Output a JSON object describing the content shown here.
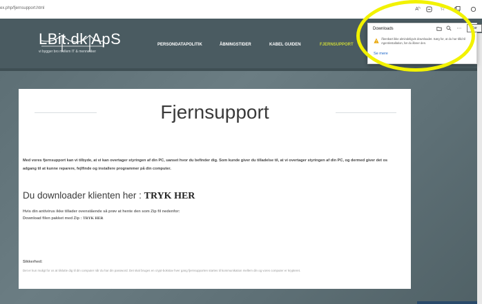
{
  "browser": {
    "url": "ex.php/fjernsupport.html",
    "read_aloud": "Aʰ",
    "tooltip": "Sor"
  },
  "site": {
    "logo": {
      "name": "LBit.dk ApS",
      "tagline": "vi bygger bro mellem IT & mennesker"
    },
    "nav": [
      {
        "label": "PERSONDATAPOLITIK"
      },
      {
        "label": "ÅBNINGSTIDER"
      },
      {
        "label": "KABEL GUIDEN"
      },
      {
        "label": "FJERNSUPPORT",
        "active": true
      }
    ],
    "page_title": "Fjernsupport",
    "intro": "Med vores fjernsupport kan vi tilbyde, at vi kan overtager styringen af din PC, uanset hvor du befinder dig. Som kunde giver du tilladelse til, at vi overtager styringen af din PC, og dermed giver det os adgang til at kunne reparere, fejlfinde og installere programmer på din computer.",
    "download_text": "Du downloader klienten her : ",
    "download_link": "TRYK HER",
    "antivirus_line1": "Hvis din antivirus ikke tillader ovenstående så prøv at hente den som Zip fil nedenfor:",
    "antivirus_line2": "Download filen pakket med Zip : ",
    "zip_link": "TRYK HER",
    "security_heading": "Sikkerhed:",
    "security_text": "Det er kun muligt for os at tilslutte dig til din computer når du har din password. Det skal bruges en crypt-bokstav hver gang fjernsupporten startes til kommunikation mellem din og vores computer er krypteret."
  },
  "downloads_panel": {
    "title": "Downloads",
    "message": "Åbenbart ikke almindeligvis downloadet. Sørg for, at du har tillid til Agentinstallation, før du åbner den.",
    "see_more": "Se mere"
  },
  "colors": {
    "accent_nav": "#c9d53a",
    "warning": "#e8a400",
    "highlight": "#f2f200"
  }
}
